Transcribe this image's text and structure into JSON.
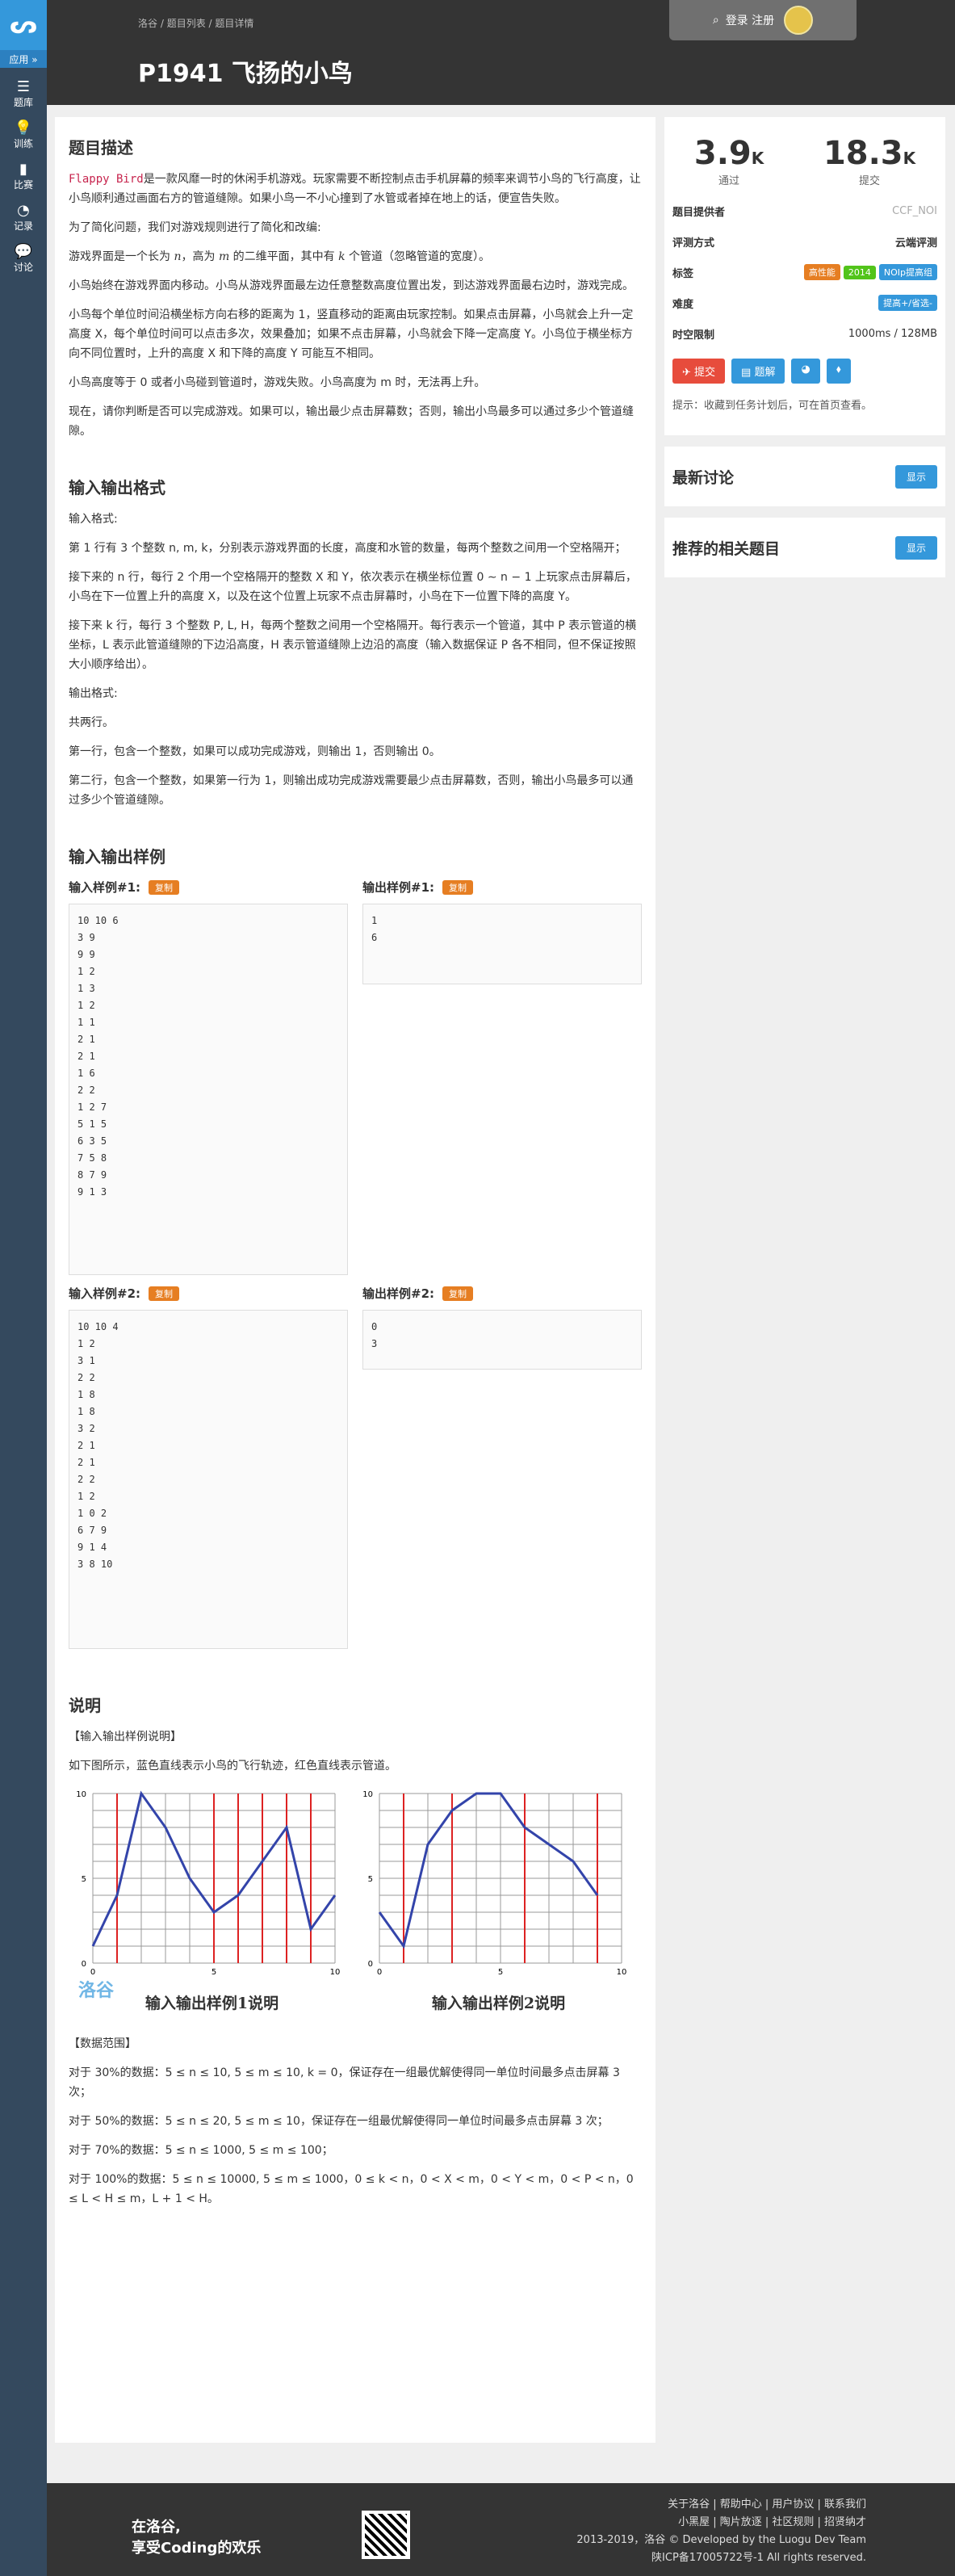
{
  "sidebar": {
    "logo": "ᔕ",
    "apps": "应用 »",
    "items": [
      {
        "icon": "☰",
        "label": "题库"
      },
      {
        "icon": "💡",
        "label": "训练"
      },
      {
        "icon": "▮",
        "label": "比赛"
      },
      {
        "icon": "◔",
        "label": "记录"
      },
      {
        "icon": "💬",
        "label": "讨论"
      }
    ]
  },
  "header": {
    "crumbs": [
      "洛谷",
      "题目列表",
      "题目详情"
    ],
    "title": "P1941 飞扬的小鸟",
    "login": "登录",
    "register": "注册"
  },
  "desc": {
    "heading": "题目描述",
    "p1_code": "Flappy Bird",
    "p1": "是一款风靡一时的休闲手机游戏。玩家需要不断控制点击手机屏幕的频率来调节小鸟的飞行高度，让小鸟顺利通过画面右方的管道缝隙。如果小鸟一不小心撞到了水管或者掉在地上的话，便宣告失败。",
    "p2": "为了简化问题，我们对游戏规则进行了简化和改编:",
    "p3a": "游戏界面是一个长为 ",
    "p3n": "n",
    "p3b": "，高为 ",
    "p3m": "m",
    "p3c": " 的二维平面，其中有 ",
    "p3k": "k",
    "p3d": " 个管道（忽略管道的宽度）。",
    "p4": "小鸟始终在游戏界面内移动。小鸟从游戏界面最左边任意整数高度位置出发，到达游戏界面最右边时，游戏完成。",
    "p5": "小鸟每个单位时间沿横坐标方向右移的距离为 1，竖直移动的距离由玩家控制。如果点击屏幕，小鸟就会上升一定高度 X，每个单位时间可以点击多次，效果叠加；如果不点击屏幕，小鸟就会下降一定高度 Y。小鸟位于横坐标方向不同位置时，上升的高度 X 和下降的高度 Y 可能互不相同。",
    "p6": "小鸟高度等于 0 或者小鸟碰到管道时，游戏失败。小鸟高度为 m 时，无法再上升。",
    "p7": "现在，请你判断是否可以完成游戏。如果可以，输出最少点击屏幕数；否则，输出小鸟最多可以通过多少个管道缝隙。"
  },
  "io": {
    "heading": "输入输出格式",
    "in_title": "输入格式:",
    "in1": "第 1 行有 3 个整数 n, m, k，分别表示游戏界面的长度，高度和水管的数量，每两个整数之间用一个空格隔开；",
    "in2": "接下来的 n 行，每行 2 个用一个空格隔开的整数 X 和 Y，依次表示在横坐标位置 0 ∼ n − 1 上玩家点击屏幕后，小鸟在下一位置上升的高度 X，以及在这个位置上玩家不点击屏幕时，小鸟在下一位置下降的高度 Y。",
    "in3": "接下来 k 行，每行 3 个整数 P, L, H，每两个整数之间用一个空格隔开。每行表示一个管道，其中 P 表示管道的横坐标，L 表示此管道缝隙的下边沿高度，H 表示管道缝隙上边沿的高度（输入数据保证 P 各不相同，但不保证按照大小顺序给出）。",
    "out_title": "输出格式:",
    "out1": "共两行。",
    "out2": "第一行，包含一个整数，如果可以成功完成游戏，则输出 1，否则输出 0。",
    "out3": "第二行，包含一个整数，如果第一行为 1，则输出成功完成游戏需要最少点击屏幕数，否则，输出小鸟最多可以通过多少个管道缝隙。"
  },
  "samples": {
    "heading": "输入输出样例",
    "copy": "复制",
    "in1_label": "输入样例#1:",
    "out1_label": "输出样例#1:",
    "in2_label": "输入样例#2:",
    "out2_label": "输出样例#2:",
    "in1": "10 10 6\n3 9\n9 9\n1 2\n1 3\n1 2\n1 1\n2 1\n2 1\n1 6\n2 2\n1 2 7\n5 1 5\n6 3 5\n7 5 8\n8 7 9\n9 1 3",
    "out1": "1\n6",
    "in2": "10 10 4\n1 2\n3 1\n2 2\n1 8\n1 8\n3 2\n2 1\n2 1\n2 2\n1 2\n1 0 2\n6 7 9\n9 1 4\n3 8 10",
    "out2": "0\n3"
  },
  "notes": {
    "heading": "说明",
    "n1": "【输入输出样例说明】",
    "n2": "如下图所示，蓝色直线表示小鸟的飞行轨迹，红色直线表示管道。",
    "fig1_caption": "输入输出样例1说明",
    "fig2_caption": "输入输出样例2说明",
    "watermark": "洛谷",
    "range": "【数据范围】",
    "r1": "对于 30%的数据：5 ≤ n ≤ 10, 5 ≤ m ≤ 10, k = 0，保证存在一组最优解使得同一单位时间最多点击屏幕 3 次；",
    "r2": "对于 50%的数据：5 ≤ n ≤ 20, 5 ≤ m ≤ 10，保证存在一组最优解使得同一单位时间最多点击屏幕 3 次；",
    "r3": "对于 70%的数据：5 ≤ n ≤ 1000, 5 ≤ m ≤ 100；",
    "r4": "对于 100%的数据：5 ≤ n ≤ 10000, 5 ≤ m ≤ 1000，0 ≤ k < n，0 < X < m，0 < Y < m，0 < P < n，0 ≤ L < H ≤ m，L + 1 < H。"
  },
  "fig1": {
    "path": [
      [
        0,
        1
      ],
      [
        1,
        4
      ],
      [
        2,
        10
      ],
      [
        3,
        8
      ],
      [
        4,
        5
      ],
      [
        5,
        3
      ],
      [
        6,
        4
      ],
      [
        7,
        6
      ],
      [
        8,
        8
      ],
      [
        9,
        2
      ],
      [
        10,
        4
      ]
    ],
    "pipes": [
      1,
      5,
      6,
      7,
      8,
      9
    ],
    "xticks": [
      "0",
      "5",
      "10"
    ],
    "yticks": [
      "0",
      "5",
      "10"
    ]
  },
  "fig2": {
    "path": [
      [
        0,
        3
      ],
      [
        1,
        1
      ],
      [
        2,
        7
      ],
      [
        3,
        9
      ],
      [
        4,
        10
      ],
      [
        5,
        10
      ],
      [
        6,
        8
      ],
      [
        7,
        7
      ],
      [
        8,
        6
      ],
      [
        9,
        4
      ]
    ],
    "pipes": [
      1,
      6,
      9,
      3
    ],
    "xticks": [
      "0",
      "5",
      "10"
    ],
    "yticks": [
      "0",
      "5",
      "10"
    ]
  },
  "stats": {
    "pass": "3.9",
    "pass_unit": "K",
    "pass_label": "通过",
    "submit": "18.3",
    "submit_unit": "K",
    "submit_label": "提交"
  },
  "meta": {
    "provider_label": "题目提供者",
    "provider": "CCF_NOI",
    "judge_label": "评测方式",
    "judge": "云端评测",
    "tags_label": "标签",
    "tags": [
      "高性能",
      "2014",
      "NOIp提高组"
    ],
    "diff_label": "难度",
    "diff": "提高+/省选-",
    "limit_label": "时空限制",
    "limit": "1000ms / 128MB",
    "btn_submit": "提交",
    "btn_solution": "题解",
    "hint": "提示：收藏到任务计划后，可在首页查看。"
  },
  "discuss": {
    "title": "最新讨论",
    "show": "显示"
  },
  "related": {
    "title": "推荐的相关题目",
    "show": "显示"
  },
  "footer": {
    "slogan1": "在洛谷,",
    "slogan2": "享受Coding的欢乐",
    "l1": "关于洛谷 | 帮助中心 | 用户协议 | 联系我们",
    "l2": "小黑屋 | 陶片放逐 | 社区规则 | 招贤纳才",
    "l3": "2013-2019，洛谷 © Developed by the Luogu Dev Team",
    "l4": "陕ICP备17005722号-1 All rights reserved."
  },
  "colors": {
    "tag_perf": "#e67e22",
    "tag_year": "#52c41a",
    "tag_noip": "#3498db",
    "diff": "#3498db",
    "submit": "#e74c3c",
    "solution": "#3498db"
  }
}
